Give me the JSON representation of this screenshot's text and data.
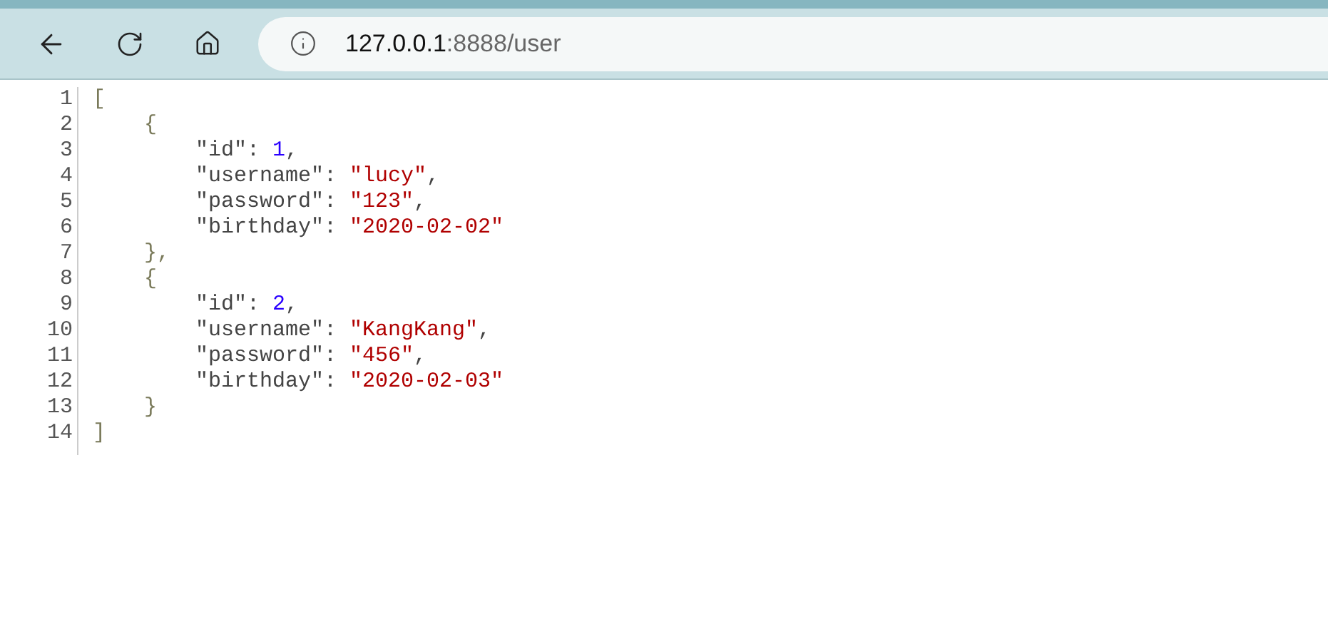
{
  "address_bar": {
    "host": "127.0.0.1",
    "rest": ":8888/user"
  },
  "code": {
    "lines": [
      {
        "number": "1",
        "tokens": [
          {
            "kind": "punct",
            "text": "["
          }
        ]
      },
      {
        "number": "2",
        "tokens": [
          {
            "kind": "punct",
            "text": "    {"
          }
        ]
      },
      {
        "number": "3",
        "tokens": [
          {
            "kind": "key",
            "text": "        \"id\": "
          },
          {
            "kind": "number",
            "text": "1"
          },
          {
            "kind": "key",
            "text": ","
          }
        ]
      },
      {
        "number": "4",
        "tokens": [
          {
            "kind": "key",
            "text": "        \"username\": "
          },
          {
            "kind": "string",
            "text": "\"lucy\""
          },
          {
            "kind": "key",
            "text": ","
          }
        ]
      },
      {
        "number": "5",
        "tokens": [
          {
            "kind": "key",
            "text": "        \"password\": "
          },
          {
            "kind": "string",
            "text": "\"123\""
          },
          {
            "kind": "key",
            "text": ","
          }
        ]
      },
      {
        "number": "6",
        "tokens": [
          {
            "kind": "key",
            "text": "        \"birthday\": "
          },
          {
            "kind": "string",
            "text": "\"2020-02-02\""
          }
        ]
      },
      {
        "number": "7",
        "tokens": [
          {
            "kind": "punct",
            "text": "    },"
          }
        ]
      },
      {
        "number": "8",
        "tokens": [
          {
            "kind": "punct",
            "text": "    {"
          }
        ]
      },
      {
        "number": "9",
        "tokens": [
          {
            "kind": "key",
            "text": "        \"id\": "
          },
          {
            "kind": "number",
            "text": "2"
          },
          {
            "kind": "key",
            "text": ","
          }
        ]
      },
      {
        "number": "10",
        "tokens": [
          {
            "kind": "key",
            "text": "        \"username\": "
          },
          {
            "kind": "string",
            "text": "\"KangKang\""
          },
          {
            "kind": "key",
            "text": ","
          }
        ]
      },
      {
        "number": "11",
        "tokens": [
          {
            "kind": "key",
            "text": "        \"password\": "
          },
          {
            "kind": "string",
            "text": "\"456\""
          },
          {
            "kind": "key",
            "text": ","
          }
        ]
      },
      {
        "number": "12",
        "tokens": [
          {
            "kind": "key",
            "text": "        \"birthday\": "
          },
          {
            "kind": "string",
            "text": "\"2020-02-03\""
          }
        ]
      },
      {
        "number": "13",
        "tokens": [
          {
            "kind": "punct",
            "text": "    }"
          }
        ]
      },
      {
        "number": "14",
        "tokens": [
          {
            "kind": "punct",
            "text": "]"
          }
        ]
      }
    ]
  }
}
